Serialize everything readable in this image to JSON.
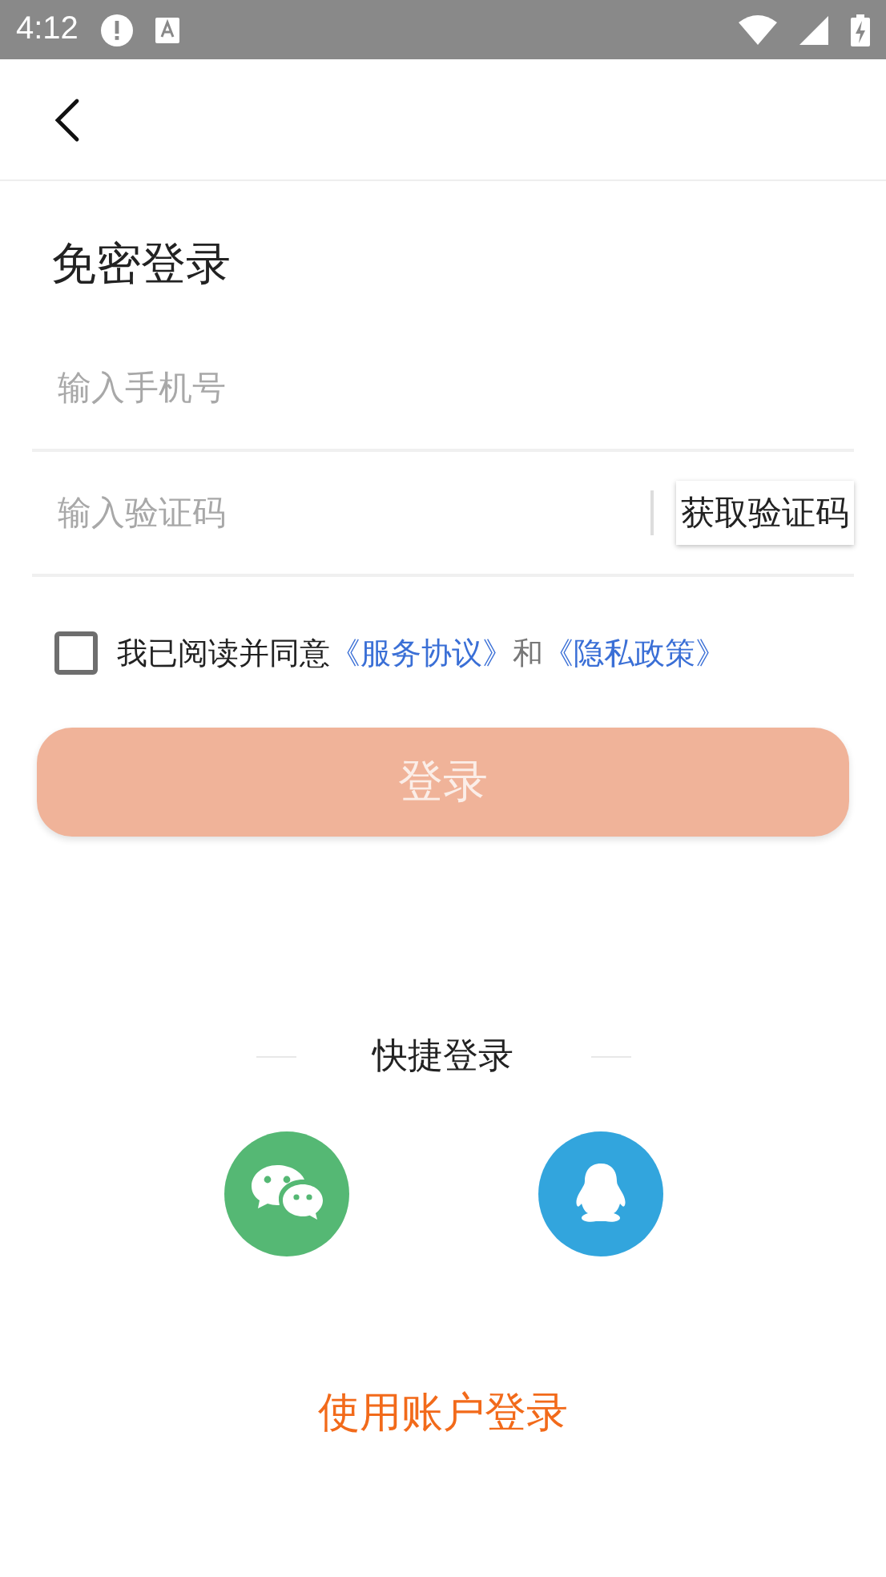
{
  "status_bar": {
    "time": "4:12"
  },
  "title": "免密登录",
  "phone_field": {
    "placeholder": "输入手机号"
  },
  "code_field": {
    "placeholder": "输入验证码"
  },
  "get_code_button": "获取验证码",
  "agreement": {
    "checked": false,
    "text": "我已阅读并同意",
    "links": [
      "《服务协议》",
      "《隐私政策》"
    ],
    "connector": "和"
  },
  "login_button": {
    "label": "登录",
    "disabled": true
  },
  "quick_login": {
    "label": "快捷登录",
    "providers": [
      {
        "kind": "wechat"
      },
      {
        "kind": "qq"
      }
    ]
  },
  "account_login": "使用账户登录"
}
